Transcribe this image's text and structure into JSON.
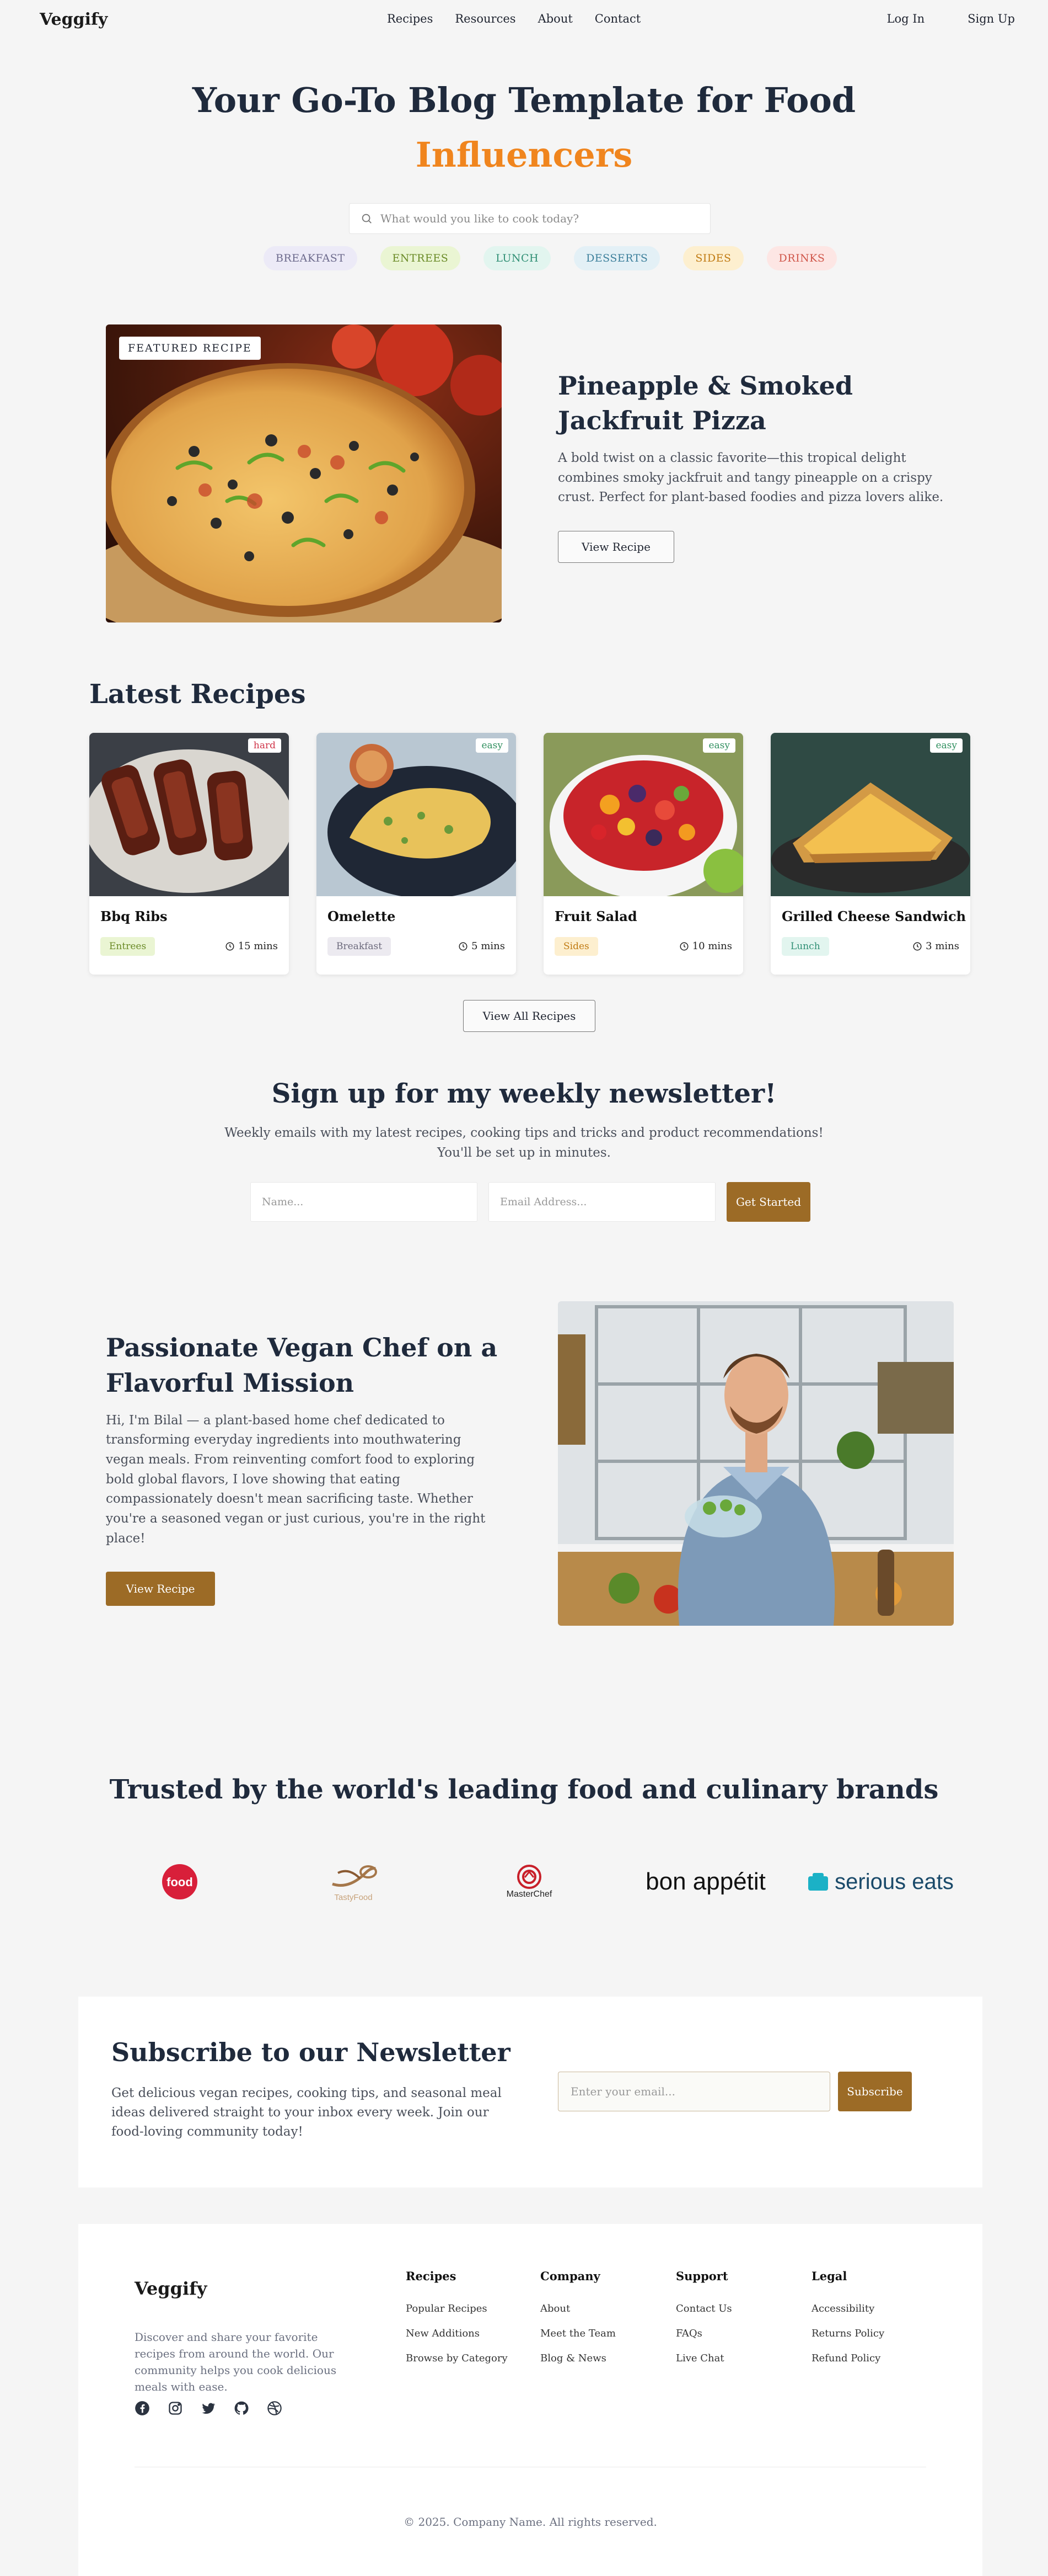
{
  "nav": {
    "logo": "Veggify",
    "links": [
      "Recipes",
      "Resources",
      "About",
      "Contact"
    ],
    "login": "Log In",
    "signup": "Sign Up"
  },
  "hero": {
    "title_line1": "Your Go-To Blog Template for Food",
    "title_line2": "Influencers",
    "accent_color": "#f0851e",
    "search_placeholder": "What would you like to cook today?",
    "chips": [
      {
        "label": "BREAKFAST",
        "bg": "#eceaf7",
        "color": "#6c6a8c"
      },
      {
        "label": "ENTREES",
        "bg": "#eaf5d3",
        "color": "#6a8a26"
      },
      {
        "label": "LUNCH",
        "bg": "#e2f5ef",
        "color": "#2f8f74"
      },
      {
        "label": "DESSERTS",
        "bg": "#e3f0f6",
        "color": "#3c7f9b"
      },
      {
        "label": "SIDES",
        "bg": "#fdefcf",
        "color": "#c07a12"
      },
      {
        "label": "DRINKS",
        "bg": "#fde6e4",
        "color": "#d0564a"
      }
    ]
  },
  "featured": {
    "badge": "FEATURED RECIPE",
    "title": "Pineapple & Smoked Jackfruit Pizza",
    "description": "A bold twist on a classic favorite—this tropical delight combines smoky jackfruit and tangy pineapple on a crispy crust. Perfect for plant-based foodies and pizza lovers alike.",
    "button": "View Recipe"
  },
  "latest": {
    "title": "Latest Recipes",
    "view_all": "View All Recipes",
    "recipes": [
      {
        "name": "Bbq Ribs",
        "difficulty": "hard",
        "diff_color": "#d0364a",
        "category": "Entrees",
        "cat_bg": "#eaf5d3",
        "cat_color": "#6a8a26",
        "time": "15 mins"
      },
      {
        "name": "Omelette",
        "difficulty": "easy",
        "diff_color": "#2f8f5e",
        "category": "Breakfast",
        "cat_bg": "#eceaf0",
        "cat_color": "#6c6a7c",
        "time": "5 mins"
      },
      {
        "name": "Fruit Salad",
        "difficulty": "easy",
        "diff_color": "#2f8f5e",
        "category": "Sides",
        "cat_bg": "#fdefcf",
        "cat_color": "#c07a12",
        "time": "10 mins"
      },
      {
        "name": "Grilled Cheese Sandwich",
        "difficulty": "easy",
        "diff_color": "#2f8f5e",
        "category": "Lunch",
        "cat_bg": "#e2f5ef",
        "cat_color": "#2f8f74",
        "time": "3 mins"
      }
    ]
  },
  "newsletter": {
    "title": "Sign up for my weekly newsletter!",
    "desc_line1": "Weekly emails with my latest recipes, cooking tips and tricks and product recommendations!",
    "desc_line2": "You'll be set up in minutes.",
    "name_placeholder": "Name...",
    "email_placeholder": "Email Address...",
    "button": "Get Started"
  },
  "about": {
    "title": "Passionate Vegan Chef on a Flavorful Mission",
    "description": "Hi, I'm Bilal — a plant-based home chef dedicated to transforming everyday ingredients into mouthwatering vegan meals. From reinventing comfort food to exploring bold global flavors, I love showing that eating compassionately doesn't mean sacrificing taste. Whether you're a seasoned vegan or just curious, you're in the right place!",
    "button": "View Recipe"
  },
  "brands": {
    "title": "Trusted by the world's leading food and culinary brands",
    "items": [
      {
        "name": "food",
        "icon": "food-network-logo"
      },
      {
        "name": "TastyFood",
        "icon": "tastyfood-logo"
      },
      {
        "name": "MasterChef",
        "icon": "masterchef-logo"
      },
      {
        "name": "bon appétit",
        "icon": "bon-appetit-logo"
      },
      {
        "name": "serious eats",
        "icon": "serious-eats-logo"
      }
    ]
  },
  "subscribe": {
    "title": "Subscribe to our Newsletter",
    "description": "Get delicious vegan recipes, cooking tips, and seasonal meal ideas delivered straight to your inbox every week. Join our food-loving community today!",
    "placeholder": "Enter your email...",
    "button": "Subscribe",
    "button_color": "#9c6b26"
  },
  "footer": {
    "logo": "Veggify",
    "description": "Discover and share your favorite recipes from around the world. Our community helps you cook delicious meals with ease.",
    "columns": [
      {
        "title": "Recipes",
        "links": [
          "Popular Recipes",
          "New Additions",
          "Browse by Category"
        ]
      },
      {
        "title": "Company",
        "links": [
          "About",
          "Meet the Team",
          "Blog & News"
        ]
      },
      {
        "title": "Support",
        "links": [
          "Contact Us",
          "FAQs",
          "Live Chat"
        ]
      },
      {
        "title": "Legal",
        "links": [
          "Accessibility",
          "Returns Policy",
          "Refund Policy"
        ]
      }
    ],
    "social": [
      "facebook-icon",
      "instagram-icon",
      "twitter-icon",
      "github-icon",
      "dribbble-icon"
    ],
    "copyright": "© 2025. Company Name. All rights reserved."
  }
}
